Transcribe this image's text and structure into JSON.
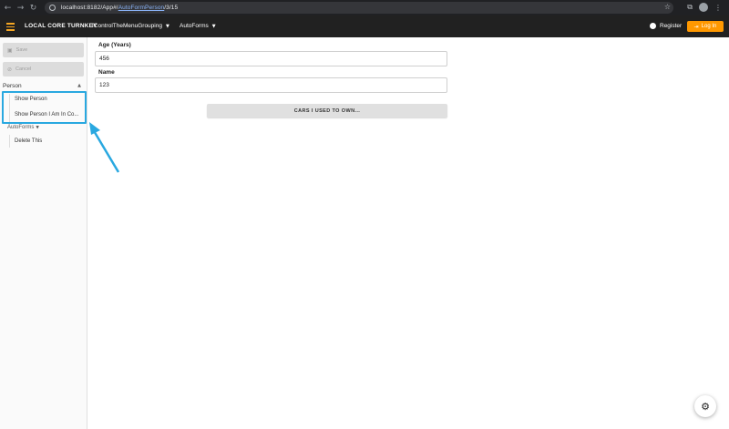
{
  "browser": {
    "url_prefix": "localhost:8182/App#/",
    "url_highlight": "AutoFormPerson",
    "url_suffix": "/3/15"
  },
  "appbar": {
    "brand": "LOCAL CORE TURNKEY",
    "menu1": "IControlTheMenuGrouping",
    "menu2": "AutoForms",
    "register": "Register",
    "login": "Log In"
  },
  "sidebar": {
    "save_label": "Save",
    "cancel_label": "Cancel",
    "person_section": "Person",
    "person_items": [
      "Show Person",
      "Show Person I Am In Co..."
    ],
    "autoforms_section": "AutoForms",
    "autoforms_items": [
      "Delete This"
    ]
  },
  "form": {
    "age_label": "Age (Years)",
    "age_value": "456",
    "name_label": "Name",
    "name_value": "123",
    "cars_button": "CARS I USED TO OWN..."
  },
  "colors": {
    "appbar_bg": "#212121",
    "accent": "#ff9800",
    "annotation": "#29a8e0"
  }
}
